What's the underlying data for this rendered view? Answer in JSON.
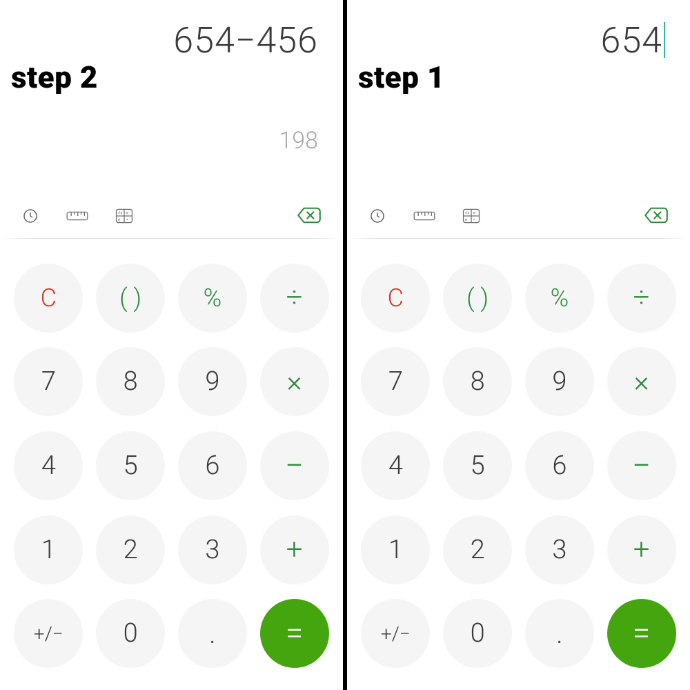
{
  "left": {
    "step_label": "step 2",
    "expression": "654−456",
    "show_cursor": false,
    "result": "198"
  },
  "right": {
    "step_label": "step 1",
    "expression": "654",
    "show_cursor": true,
    "result": ""
  },
  "toolbelt": {
    "history_icon": "history",
    "ruler_icon": "ruler",
    "scientific_icon": "scientific",
    "backspace_icon": "backspace"
  },
  "keys": {
    "clear": "C",
    "paren": "( )",
    "percent": "%",
    "divide": "÷",
    "k7": "7",
    "k8": "8",
    "k9": "9",
    "multiply": "×",
    "k4": "4",
    "k5": "5",
    "k6": "6",
    "minus": "−",
    "k1": "1",
    "k2": "2",
    "k3": "3",
    "plus": "+",
    "sign": "+/−",
    "k0": "0",
    "dot": ".",
    "equals": "="
  }
}
